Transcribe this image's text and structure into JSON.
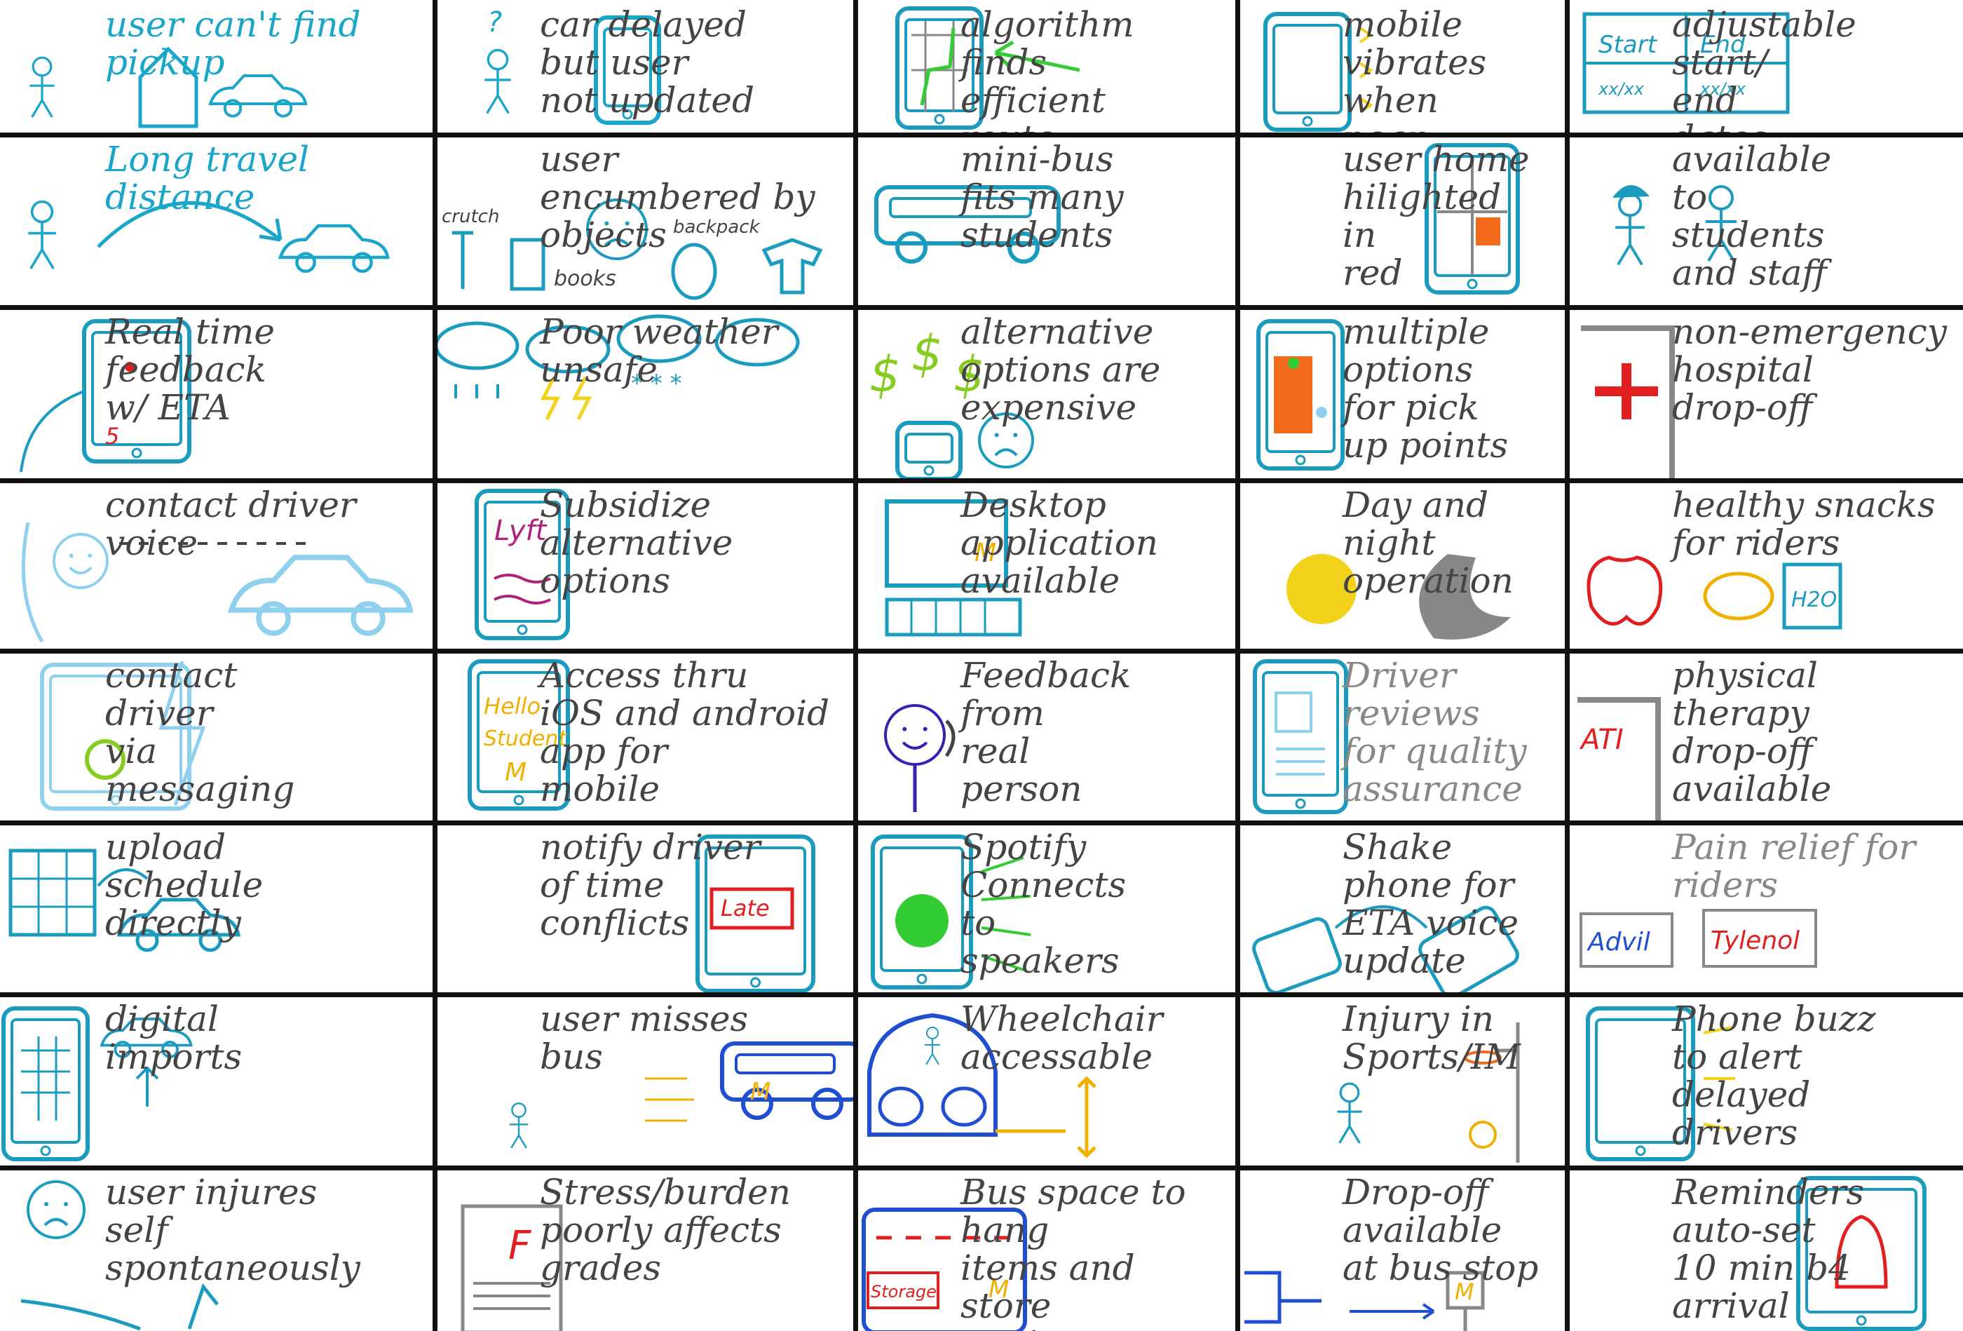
{
  "colors": {
    "ink_dark": "#444444",
    "ink_cyan": "#1aa6c9",
    "ink_teal": "#1b9cbf",
    "ink_light_blue": "#8fd0ef",
    "ink_blue": "#1f4fd0",
    "ink_green": "#33cc33",
    "ink_lime": "#88cc22",
    "ink_red": "#e02020",
    "ink_orange": "#f26a1b",
    "ink_yellow": "#f2d21b",
    "ink_gold": "#f0b000",
    "ink_gray": "#888888",
    "ink_purple": "#3a1fb0",
    "grid": "#111111"
  },
  "rows": [
    [
      {
        "text": "user can't find pickup",
        "color": "#1aa6c9",
        "icon": "stick-figure-house-car-icon"
      },
      {
        "text": "car delayed\nbut user\nnot updated",
        "color": "#444444",
        "icon": "confused-figure-phone-icon"
      },
      {
        "text": "algorithm\nfinds\nefficient\nroute",
        "color": "#444444",
        "icon": "phone-map-route-icon"
      },
      {
        "text": "mobile\nvibrates\nwhen\nnear",
        "color": "#444444",
        "icon": "vibrating-phone-icon"
      },
      {
        "text": "adjustable\nstart/\nend\ndates",
        "color": "#444444",
        "icon": "start-end-form-icon",
        "labels": [
          "Start",
          "End",
          "xx/xx",
          "xx/xx"
        ]
      }
    ],
    [
      {
        "text": "Long travel distance",
        "color": "#1aa6c9",
        "icon": "figure-arrow-car-icon"
      },
      {
        "text": "user encumbered by\nobjects",
        "color": "#444444",
        "icon": "crutch-books-backpack-icon",
        "labels": [
          "crutch",
          "books",
          "backpack"
        ]
      },
      {
        "text": "mini-bus\nfits many\nstudents",
        "color": "#444444",
        "icon": "mini-bus-icon"
      },
      {
        "text": "user home\nhilighted\nin\nred",
        "color": "#444444",
        "icon": "phone-map-home-icon"
      },
      {
        "text": "available\nto\nstudents\nand staff",
        "color": "#444444",
        "icon": "two-figures-icon"
      }
    ],
    [
      {
        "text": "Real time\nfeedback\nw/ ETA",
        "color": "#444444",
        "icon": "phone-eta-icon",
        "labels": [
          "5"
        ]
      },
      {
        "text": "Poor weather unsafe",
        "color": "#444444",
        "icon": "storm-clouds-icon"
      },
      {
        "text": "alternative\noptions are\nexpensive",
        "color": "#444444",
        "icon": "dollar-sad-face-icon"
      },
      {
        "text": "multiple\noptions\nfor pick\nup points",
        "color": "#444444",
        "icon": "phone-pickup-points-icon"
      },
      {
        "text": "non-emergency\nhospital\ndrop-off",
        "color": "#444444",
        "icon": "hospital-cross-icon"
      }
    ],
    [
      {
        "text": "contact driver\nvoice",
        "color": "#444444",
        "icon": "voice-call-car-icon"
      },
      {
        "text": "Subsidize\nalternative\noptions",
        "color": "#444444",
        "icon": "lyft-phone-icon",
        "labels": [
          "Lyft"
        ]
      },
      {
        "text": "Desktop\napplication\navailable",
        "color": "#444444",
        "icon": "desktop-computer-icon"
      },
      {
        "text": "Day and night\noperation",
        "color": "#444444",
        "icon": "sun-moon-icon"
      },
      {
        "text": "healthy snacks\nfor riders",
        "color": "#444444",
        "icon": "apple-water-icon",
        "labels": [
          "H2O"
        ]
      }
    ],
    [
      {
        "text": "contact\ndriver\nvia\nmessaging",
        "color": "#444444",
        "icon": "messaging-phone-icon"
      },
      {
        "text": "Access thru\niOS and android\napp for\nmobile",
        "color": "#444444",
        "icon": "hello-student-phone-icon",
        "labels": [
          "Hello",
          "Student"
        ]
      },
      {
        "text": "Feedback\nfrom\nreal\nperson",
        "color": "#444444",
        "icon": "headset-person-icon"
      },
      {
        "text": "Driver\nreviews\nfor quality\nassurance",
        "color": "#888888",
        "icon": "review-phone-icon"
      },
      {
        "text": "physical therapy\ndrop-off\navailable",
        "color": "#444444",
        "icon": "ati-building-icon",
        "labels": [
          "ATI"
        ]
      }
    ],
    [
      {
        "text": "upload\nschedule\ndirectly",
        "color": "#444444",
        "icon": "calendar-car-icon"
      },
      {
        "text": "notify driver\nof time\nconflicts",
        "color": "#444444",
        "icon": "late-phone-icon",
        "labels": [
          "Late"
        ]
      },
      {
        "text": "Spotify\nConnects\nto\nspeakers",
        "color": "#444444",
        "icon": "spotify-phone-icon"
      },
      {
        "text": "Shake phone for\nETA voice update",
        "color": "#444444",
        "icon": "shake-phone-icon"
      },
      {
        "text": "Pain relief for\nriders",
        "color": "#888888",
        "icon": "pill-boxes-icon",
        "labels": [
          "Advil",
          "Tylenol"
        ]
      }
    ],
    [
      {
        "text": "digital\nimports",
        "color": "#444444",
        "icon": "phone-grid-car-icon"
      },
      {
        "text": "user misses\nbus",
        "color": "#444444",
        "icon": "missed-bus-icon"
      },
      {
        "text": "Wheelchair\naccessable",
        "color": "#444444",
        "icon": "wheelchair-bus-icon"
      },
      {
        "text": "Injury in\nSports/IM",
        "color": "#444444",
        "icon": "basketball-hoop-icon"
      },
      {
        "text": "Phone buzz\nto alert\ndelayed\ndrivers",
        "color": "#444444",
        "icon": "buzzing-phone-icon"
      }
    ],
    [
      {
        "text": "user injures\nself\nspontaneously",
        "color": "#444444",
        "icon": "sad-face-fall-icon"
      },
      {
        "text": "Stress/burden\npoorly affects\ngrades",
        "color": "#444444",
        "icon": "failing-paper-icon",
        "labels": [
          "F"
        ]
      },
      {
        "text": "Bus space to hang\nitems and\nstore\nequipment",
        "color": "#444444",
        "icon": "storage-bus-icon",
        "labels": [
          "Storage"
        ]
      },
      {
        "text": "Drop-off available\nat bus stop",
        "color": "#444444",
        "icon": "bus-stop-icon"
      },
      {
        "text": "Reminders\nauto-set\n10 min b4\narrival",
        "color": "#444444",
        "icon": "alarm-phone-icon"
      }
    ]
  ]
}
